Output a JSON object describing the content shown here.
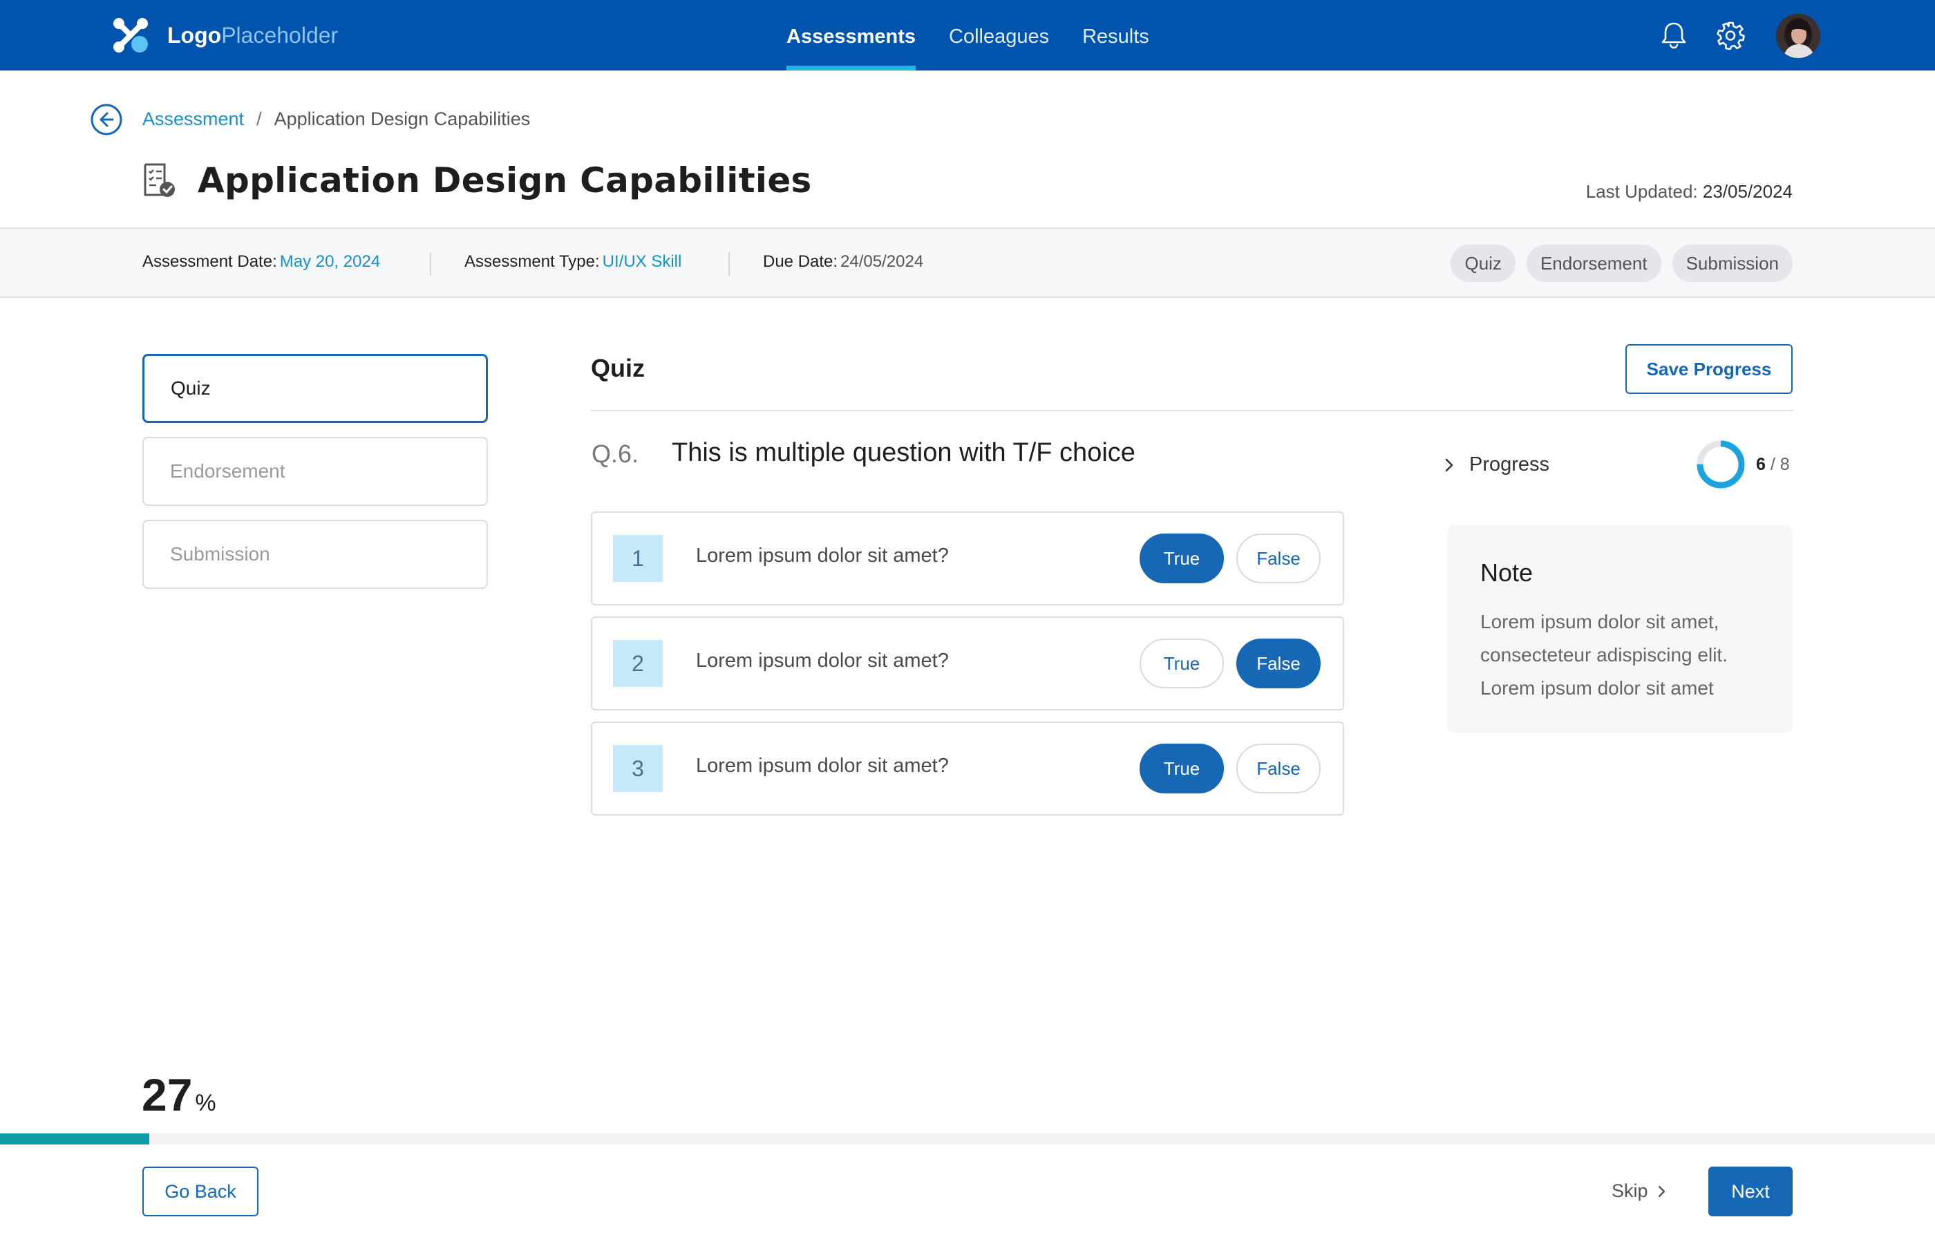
{
  "header": {
    "logo_bold": "Logo",
    "logo_light": "Placeholder",
    "nav": [
      {
        "label": "Assessments",
        "active": true
      },
      {
        "label": "Colleagues",
        "active": false
      },
      {
        "label": "Results",
        "active": false
      }
    ],
    "icons": [
      "bell-icon",
      "gear-icon",
      "avatar"
    ]
  },
  "breadcrumb": {
    "parent": "Assessment",
    "separator": "/",
    "current": "Application Design Capabilities"
  },
  "page": {
    "title": "Application Design Capabilities",
    "last_updated_label": "Last Updated:",
    "last_updated_value": "23/05/2024"
  },
  "info": {
    "assessment_date_label": "Assessment Date:",
    "assessment_date_value": "May 20, 2024",
    "assessment_type_label": "Assessment Type:",
    "assessment_type_value": "UI/UX Skill",
    "due_date_label": "Due Date:",
    "due_date_value": "24/05/2024",
    "pills": [
      "Quiz",
      "Endorsement",
      "Submission"
    ]
  },
  "steps": [
    {
      "label": "Quiz",
      "active": true
    },
    {
      "label": "Endorsement",
      "active": false
    },
    {
      "label": "Submission",
      "active": false
    }
  ],
  "quiz": {
    "section_title": "Quiz",
    "save_label": "Save Progress",
    "question_number": "Q.6.",
    "question_text": "This is multiple question with T/F choice",
    "answers": [
      {
        "index": "1",
        "text": "Lorem ipsum dolor sit amet?",
        "true_label": "True",
        "false_label": "False",
        "selected": "true"
      },
      {
        "index": "2",
        "text": "Lorem ipsum dolor sit amet?",
        "true_label": "True",
        "false_label": "False",
        "selected": "false"
      },
      {
        "index": "3",
        "text": "Lorem ipsum dolor sit amet?",
        "true_label": "True",
        "false_label": "False",
        "selected": "true"
      }
    ]
  },
  "progress": {
    "label": "Progress",
    "current": 6,
    "separator": " / ",
    "total": 8
  },
  "note": {
    "title": "Note",
    "body": "Lorem ipsum dolor sit amet, consecteteur adispiscing elit. Lorem ipsum dolor sit amet"
  },
  "footer": {
    "percent_value": 27,
    "percent_sign": "%",
    "go_back_label": "Go Back",
    "skip_label": "Skip",
    "next_label": "Next"
  },
  "colors": {
    "brand": "#0054ae",
    "primary": "#1668b5",
    "link": "#1592c7",
    "progress": "#0e9aa7",
    "ring": "#1aa3dc"
  }
}
